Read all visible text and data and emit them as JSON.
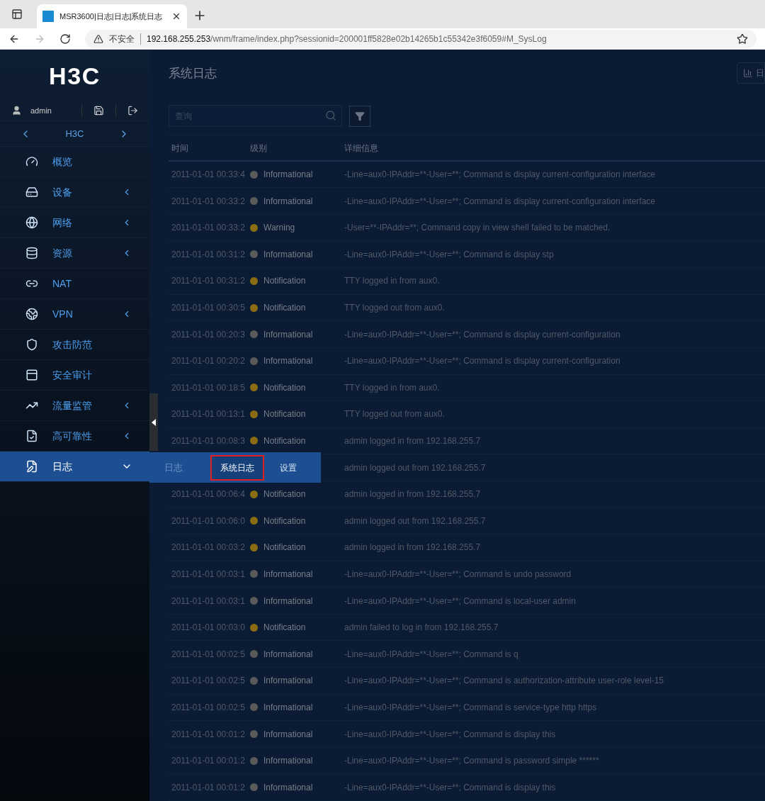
{
  "browser": {
    "tab_title": "MSR3600|日志|日志|系统日志",
    "security_label": "不安全",
    "url_host": "192.168.255.253",
    "url_path": "/wnm/frame/index.php?sessionid=200001ff5828e02b14265b1c55342e3f6059#M_SysLog"
  },
  "sidebar": {
    "logo": "H3C",
    "user": "admin",
    "device": "H3C",
    "items": [
      {
        "label": "概览",
        "has_submenu": false,
        "selected": false
      },
      {
        "label": "设备",
        "has_submenu": true,
        "expanded": false,
        "selected": false
      },
      {
        "label": "网络",
        "has_submenu": true,
        "expanded": false,
        "selected": false
      },
      {
        "label": "资源",
        "has_submenu": true,
        "expanded": false,
        "selected": false
      },
      {
        "label": "NAT",
        "has_submenu": false,
        "selected": false
      },
      {
        "label": "VPN",
        "has_submenu": true,
        "expanded": false,
        "selected": false
      },
      {
        "label": "攻击防范",
        "has_submenu": false,
        "selected": false
      },
      {
        "label": "安全审计",
        "has_submenu": false,
        "selected": false
      },
      {
        "label": "流量监管",
        "has_submenu": true,
        "expanded": false,
        "selected": false
      },
      {
        "label": "高可靠性",
        "has_submenu": true,
        "expanded": false,
        "selected": false
      },
      {
        "label": "日志",
        "has_submenu": true,
        "expanded": true,
        "selected": true
      }
    ],
    "submenu": {
      "title": "日志",
      "items": [
        {
          "label": "系统日志",
          "selected": true
        },
        {
          "label": "设置",
          "selected": false
        }
      ]
    }
  },
  "page": {
    "title": "系统日志",
    "corner_button": "日",
    "search": {
      "placeholder": "查询"
    },
    "table": {
      "columns": [
        "时间",
        "级别",
        "详细信息"
      ],
      "rows": [
        {
          "time": "2011-01-01 00:33:4",
          "level": "Informational",
          "color": "#5a5a5a",
          "message": "-Line=aux0-IPAddr=**-User=**; Command is display current-configuration interface"
        },
        {
          "time": "2011-01-01 00:33:2",
          "level": "Informational",
          "color": "#5a5a5a",
          "message": "-Line=aux0-IPAddr=**-User=**; Command is display current-configuration interface"
        },
        {
          "time": "2011-01-01 00:33:2",
          "level": "Warning",
          "color": "#8a6d12",
          "message": "-User=**-IPAddr=**; Command copy in view shell failed to be matched."
        },
        {
          "time": "2011-01-01 00:31:2",
          "level": "Informational",
          "color": "#5a5a5a",
          "message": "-Line=aux0-IPAddr=**-User=**; Command is display stp"
        },
        {
          "time": "2011-01-01 00:31:2",
          "level": "Notification",
          "color": "#8a6d12",
          "message": "TTY logged in from aux0."
        },
        {
          "time": "2011-01-01 00:30:5",
          "level": "Notification",
          "color": "#8a6d12",
          "message": "TTY logged out from aux0."
        },
        {
          "time": "2011-01-01 00:20:3",
          "level": "Informational",
          "color": "#5a5a5a",
          "message": "-Line=aux0-IPAddr=**-User=**; Command is display current-configuration"
        },
        {
          "time": "2011-01-01 00:20:2",
          "level": "Informational",
          "color": "#5a5a5a",
          "message": "-Line=aux0-IPAddr=**-User=**; Command is display current-configuration"
        },
        {
          "time": "2011-01-01 00:18:5",
          "level": "Notification",
          "color": "#8a6d12",
          "message": "TTY logged in from aux0."
        },
        {
          "time": "2011-01-01 00:13:1",
          "level": "Notification",
          "color": "#8a6d12",
          "message": "TTY logged out from aux0."
        },
        {
          "time": "2011-01-01 00:08:3",
          "level": "Notification",
          "color": "#8a6d12",
          "message": "admin logged in from 192.168.255.7"
        },
        {
          "message": "admin logged out from 192.168.255.7"
        },
        {
          "time": "2011-01-01 00:06:4",
          "level": "Notification",
          "color": "#8a6d12",
          "message": "admin logged in from 192.168.255.7"
        },
        {
          "time": "2011-01-01 00:06:0",
          "level": "Notification",
          "color": "#8a6d12",
          "message": "admin logged out from 192.168.255.7"
        },
        {
          "time": "2011-01-01 00:03:2",
          "level": "Notification",
          "color": "#8a6d12",
          "message": "admin logged in from 192.168.255.7"
        },
        {
          "time": "2011-01-01 00:03:1",
          "level": "Informational",
          "color": "#5a5a5a",
          "message": "-Line=aux0-IPAddr=**-User=**; Command is undo password"
        },
        {
          "time": "2011-01-01 00:03:1",
          "level": "Informational",
          "color": "#5a5a5a",
          "message": "-Line=aux0-IPAddr=**-User=**; Command is local-user admin"
        },
        {
          "time": "2011-01-01 00:03:0",
          "level": "Notification",
          "color": "#8a6d12",
          "message": "admin failed to log in from 192.168.255.7"
        },
        {
          "time": "2011-01-01 00:02:5",
          "level": "Informational",
          "color": "#5a5a5a",
          "message": "-Line=aux0-IPAddr=**-User=**; Command is q"
        },
        {
          "time": "2011-01-01 00:02:5",
          "level": "Informational",
          "color": "#5a5a5a",
          "message": "-Line=aux0-IPAddr=**-User=**; Command is authorization-attribute user-role level-15"
        },
        {
          "time": "2011-01-01 00:02:5",
          "level": "Informational",
          "color": "#5a5a5a",
          "message": "-Line=aux0-IPAddr=**-User=**; Command is service-type http https"
        },
        {
          "time": "2011-01-01 00:01:2",
          "level": "Informational",
          "color": "#5a5a5a",
          "message": "-Line=aux0-IPAddr=**-User=**; Command is display this"
        },
        {
          "time": "2011-01-01 00:01:2",
          "level": "Informational",
          "color": "#5a5a5a",
          "message": "-Line=aux0-IPAddr=**-User=**; Command is password simple ******"
        },
        {
          "time": "2011-01-01 00:01:2",
          "level": "Informational",
          "color": "#5a5a5a",
          "message": "-Line=aux0-IPAddr=**-User=**; Command is display this"
        }
      ]
    }
  }
}
